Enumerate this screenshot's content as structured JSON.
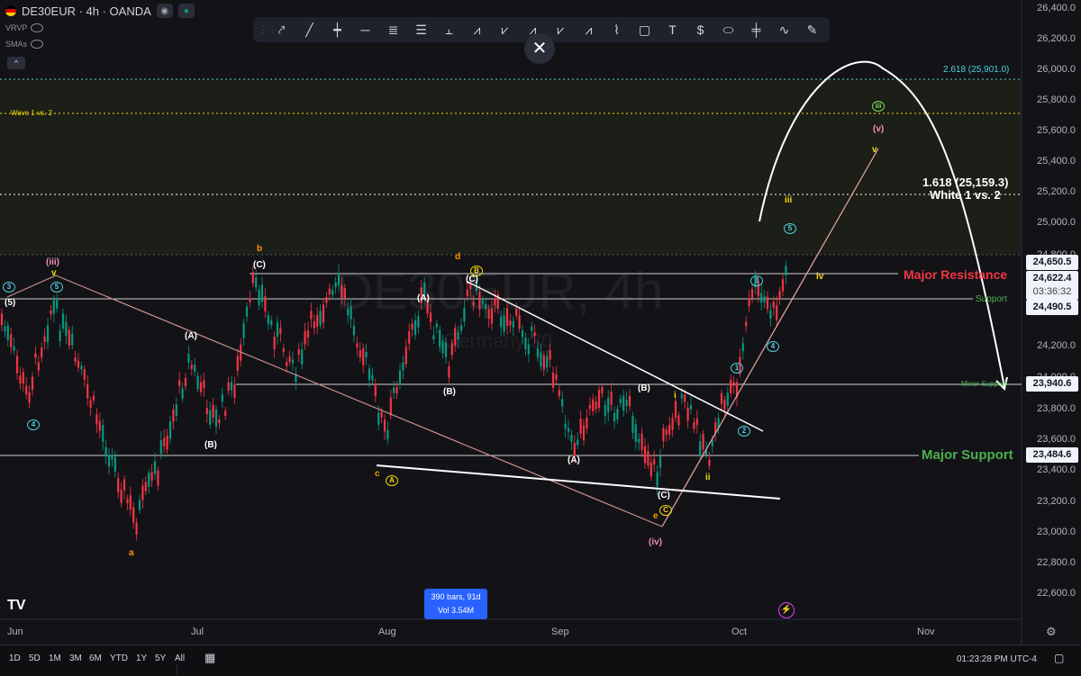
{
  "header": {
    "symbol": "DE30EUR · 4h · OANDA",
    "indicators": [
      "VRVP",
      "SMAs"
    ],
    "collapse": "^"
  },
  "toolbar": {
    "close": "✕"
  },
  "watermark": {
    "title": "DE30EUR, 4h",
    "subtitle": "Germany 30"
  },
  "price_axis": [
    "26,400.0",
    "26,200.0",
    "26,000.0",
    "25,800.0",
    "25,600.0",
    "25,400.0",
    "25,200.0",
    "25,000.0",
    "24,800.0",
    "24,200.0",
    "24,000.0",
    "23,800.0",
    "23,600.0",
    "23,400.0",
    "23,200.0",
    "23,000.0",
    "22,800.0",
    "22,600.0"
  ],
  "price_tags": {
    "p1": "24,650.5",
    "p2": "24,622.4",
    "countdown": "03:36:32",
    "p3": "24,490.5",
    "p4": "23,940.6",
    "p5": "23,484.6"
  },
  "levels": {
    "fib2618": "2.618 (25,901.0)",
    "wave12": "Wave 1 vs. 2",
    "fib1618": "1.618 (25,159.3)",
    "white12": "White 1 vs. 2",
    "major_resistance": "Major Resistance",
    "support": "Support",
    "minor_support": "Minor Support",
    "major_support": "Major Support"
  },
  "time_axis": [
    "Jun",
    "Jul",
    "Aug",
    "Sep",
    "Oct",
    "Nov"
  ],
  "bars_info": {
    "line1": "390 bars, 91d",
    "line2": "Vol 3.54M"
  },
  "ranges": [
    "1D",
    "5D",
    "1M",
    "3M",
    "6M",
    "YTD",
    "1Y",
    "5Y",
    "All"
  ],
  "clock": "01:23:28 PM UTC-4",
  "colors": {
    "bull": "#089981",
    "bear": "#f23645",
    "resistance": "#f23645",
    "support": "#4caf50",
    "fib": "#4dd0e1",
    "wave_yellow": "#f5d90a",
    "wave_orange": "#ff9800",
    "wave_pink": "#f48fb1"
  },
  "wave_labels": [
    {
      "t": "(iii)",
      "c": "pink"
    },
    {
      "t": "v",
      "c": "yellow"
    },
    {
      "t": "(5)",
      "c": "white"
    },
    {
      "t": "3",
      "c": "cyan"
    },
    {
      "t": "5",
      "c": "cyan"
    },
    {
      "t": "4",
      "c": "cyan"
    },
    {
      "t": "a",
      "c": "orange"
    },
    {
      "t": "(A)",
      "c": "white"
    },
    {
      "t": "(B)",
      "c": "white"
    },
    {
      "t": "b",
      "c": "orange"
    },
    {
      "t": "(C)",
      "c": "white"
    },
    {
      "t": "c",
      "c": "orange"
    },
    {
      "t": "A",
      "c": "yellow"
    },
    {
      "t": "d",
      "c": "orange"
    },
    {
      "t": "B",
      "c": "yellow"
    },
    {
      "t": "(C)",
      "c": "white"
    },
    {
      "t": "(A)",
      "c": "white"
    },
    {
      "t": "(B)",
      "c": "white"
    },
    {
      "t": "(A)",
      "c": "white"
    },
    {
      "t": "(B)",
      "c": "white"
    },
    {
      "t": "(C)",
      "c": "white"
    },
    {
      "t": "C",
      "c": "yellow"
    },
    {
      "t": "e",
      "c": "orange"
    },
    {
      "t": "(iv)",
      "c": "pink"
    },
    {
      "t": "i",
      "c": "yellow"
    },
    {
      "t": "ii",
      "c": "yellow"
    },
    {
      "t": "1",
      "c": "cyan"
    },
    {
      "t": "2",
      "c": "cyan"
    },
    {
      "t": "3",
      "c": "cyan"
    },
    {
      "t": "4",
      "c": "cyan"
    },
    {
      "t": "5",
      "c": "cyan"
    },
    {
      "t": "iii",
      "c": "yellow"
    },
    {
      "t": "iv",
      "c": "yellow"
    },
    {
      "t": "v",
      "c": "yellow"
    },
    {
      "t": "(v)",
      "c": "pink"
    },
    {
      "t": "iii",
      "c": "green"
    }
  ]
}
